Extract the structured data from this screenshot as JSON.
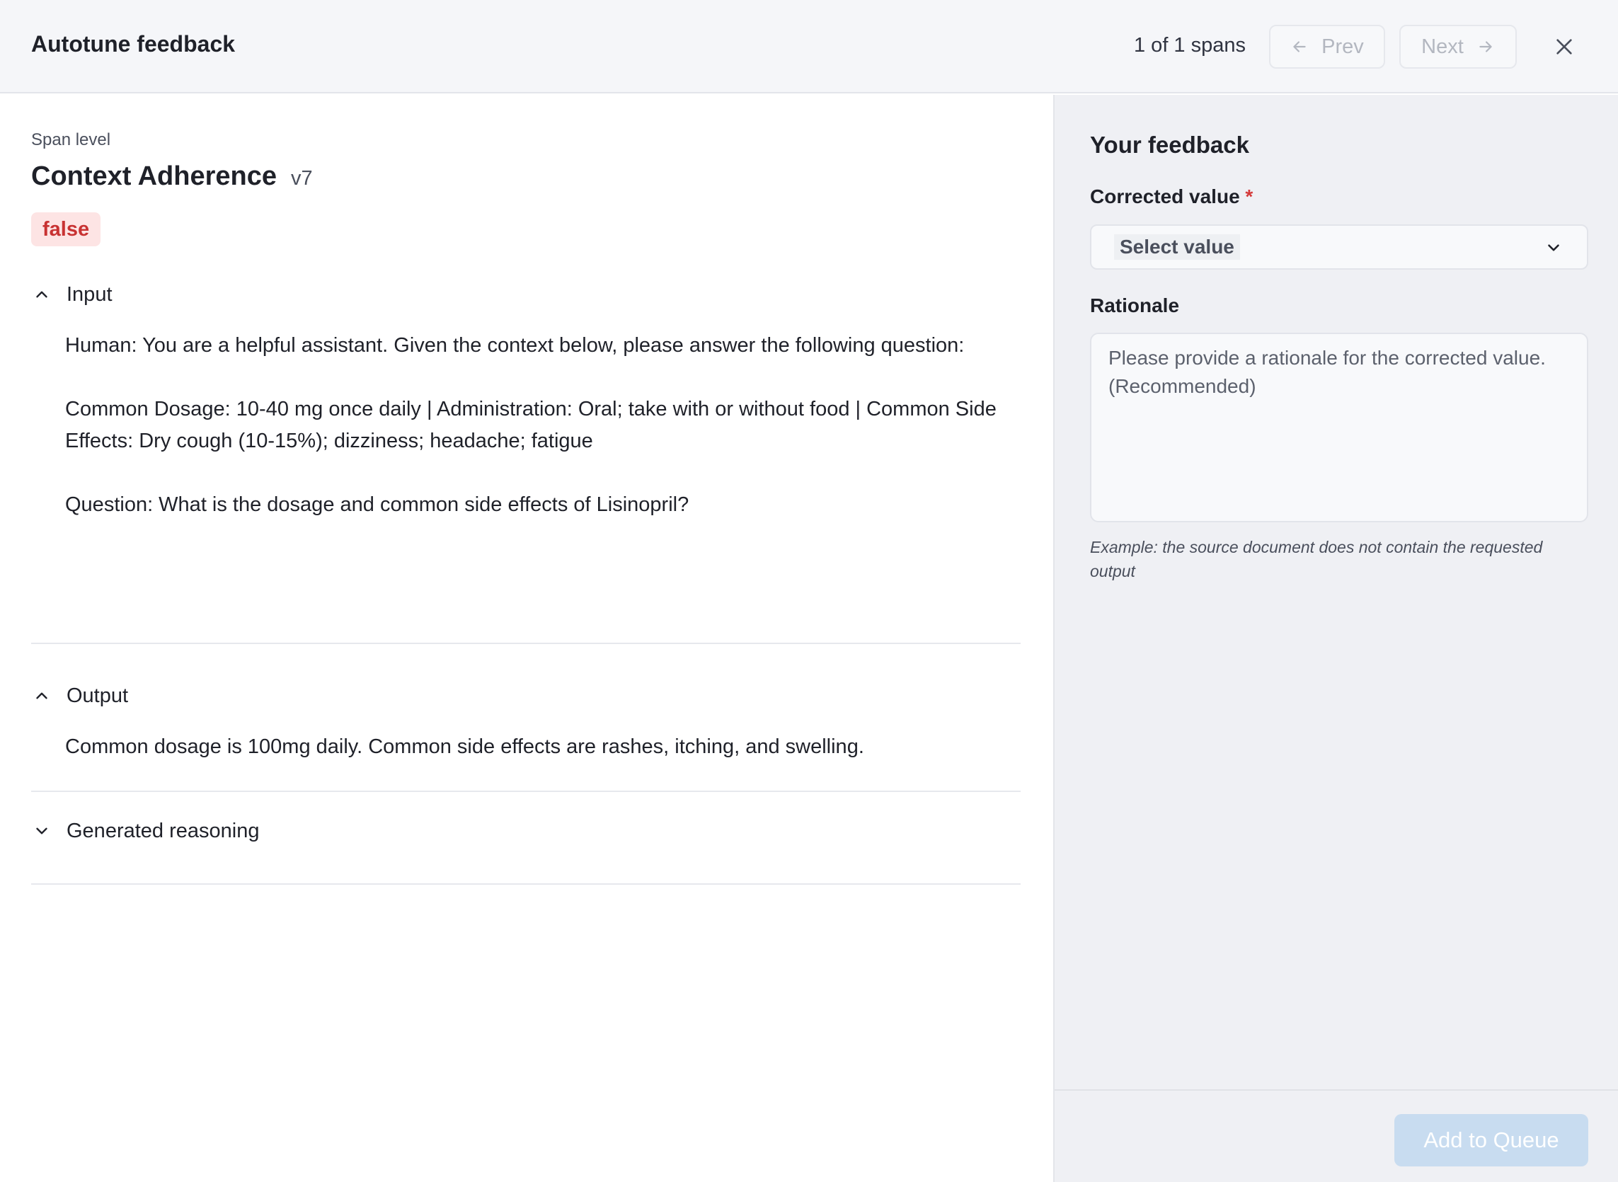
{
  "header": {
    "title": "Autotune feedback",
    "span_count": "1 of 1 spans",
    "prev_label": "Prev",
    "next_label": "Next"
  },
  "metric": {
    "level": "Span level",
    "name": "Context Adherence",
    "version": "v7",
    "value": "false"
  },
  "sections": {
    "input": {
      "title": "Input",
      "expanded": true,
      "paragraphs": [
        "Human: You are a helpful assistant. Given the context below, please answer the following question:",
        "Common Dosage: 10-40 mg once daily | Administration: Oral; take with or without food | Common Side Effects: Dry cough (10-15%); dizziness; headache; fatigue",
        "Question: What is the dosage and common side effects of Lisinopril?"
      ]
    },
    "output": {
      "title": "Output",
      "expanded": true,
      "text": "Common dosage is 100mg daily. Common side effects are rashes, itching, and swelling."
    },
    "reasoning": {
      "title": "Generated reasoning",
      "expanded": false
    }
  },
  "feedback": {
    "title": "Your feedback",
    "corrected_label": "Corrected value",
    "required_mark": "*",
    "select_value": "Select value",
    "rationale_label": "Rationale",
    "rationale_placeholder": "Please provide a rationale for the corrected value. (Recommended)",
    "rationale_value": "",
    "hint": "Example: the source document does not contain the requested output",
    "submit_label": "Add to Queue"
  },
  "colors": {
    "badge_bg": "#fde4e4",
    "badge_text": "#c83232",
    "required": "#d43a3a",
    "submit_disabled": "#c8dcf0"
  },
  "icons": [
    "arrow-left-icon",
    "arrow-right-icon",
    "close-icon",
    "chevron-up-icon",
    "chevron-down-icon"
  ]
}
